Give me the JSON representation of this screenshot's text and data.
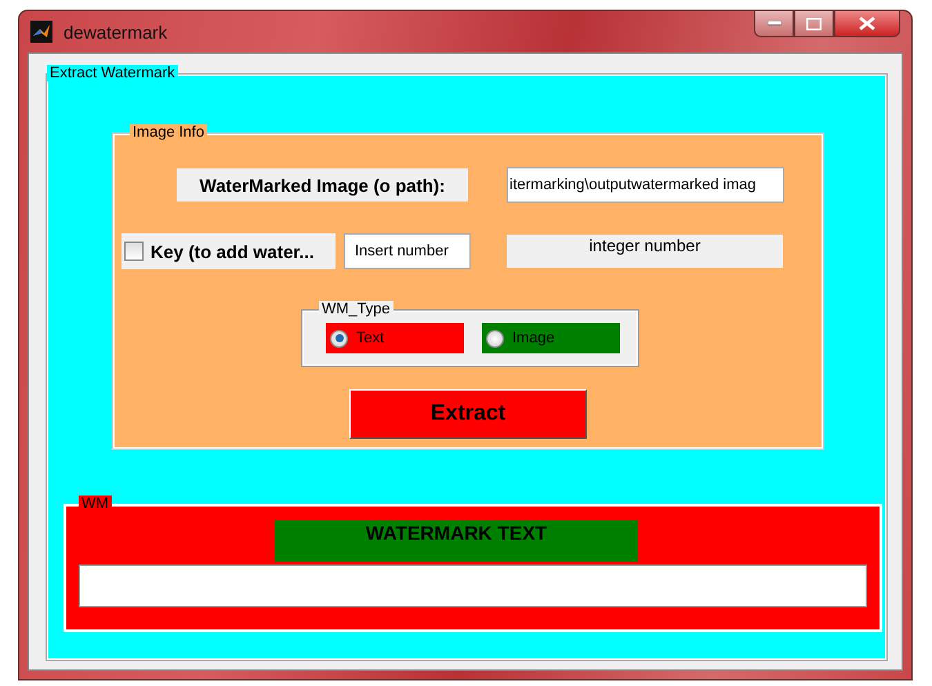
{
  "window": {
    "title": "dewatermark"
  },
  "extract_panel": {
    "title": "Extract Watermark",
    "image_info": {
      "title": "Image Info",
      "path_label": "WaterMarked Image (o path):",
      "path_field": {
        "value": "itermarking\\outputwatermarked imag"
      },
      "key_checkbox": {
        "label": "Key (to add water...",
        "checked": false
      },
      "key_field": {
        "value": "Insert number"
      },
      "key_hint": "integer number",
      "wm_type": {
        "title": "WM_Type",
        "options": [
          {
            "label": "Text",
            "selected": true,
            "color": "#ff0000"
          },
          {
            "label": "Image",
            "selected": false,
            "color": "#008000"
          }
        ]
      },
      "extract_button": "Extract"
    },
    "wm_panel": {
      "title": "WM",
      "heading": "WATERMARK TEXT"
    }
  }
}
